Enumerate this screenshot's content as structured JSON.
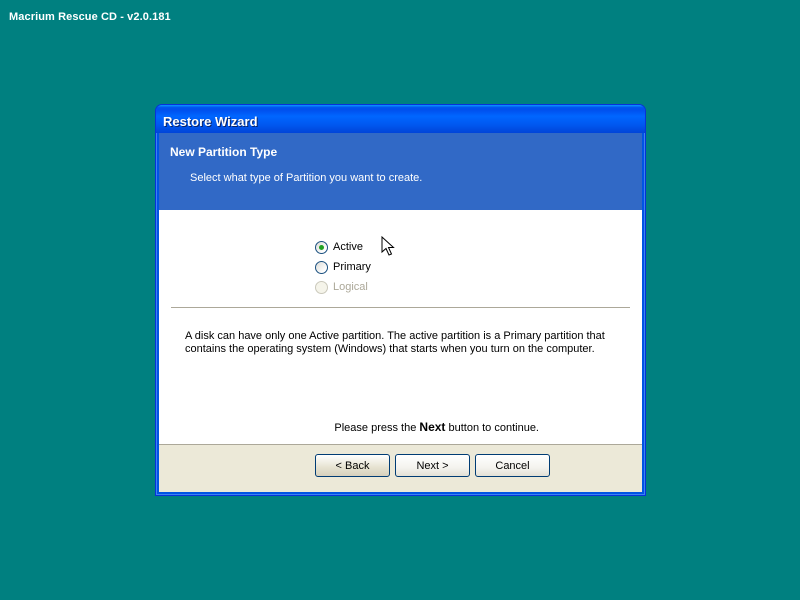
{
  "desktop": {
    "title": "Macrium Rescue CD - v2.0.181"
  },
  "dialog": {
    "title": "Restore Wizard",
    "header": {
      "title": "New Partition Type",
      "subtitle": "Select what type of Partition you want to create."
    },
    "options": [
      {
        "label": "Active",
        "checked": true,
        "disabled": false
      },
      {
        "label": "Primary",
        "checked": false,
        "disabled": false
      },
      {
        "label": "Logical",
        "checked": false,
        "disabled": true
      }
    ],
    "description": "A disk can have only one Active partition. The active partition is a Primary partition that contains the operating system (Windows) that starts when you turn on the computer.",
    "continue_text": {
      "before": "Please press the ",
      "bold": "Next",
      "after": " button to continue."
    },
    "buttons": {
      "back": "< Back",
      "next": "Next >",
      "cancel": "Cancel"
    }
  },
  "colors": {
    "desktop": "#008080",
    "header_band": "#3169c6",
    "title_bar": "#0058f0",
    "radio_check": "#21a121"
  },
  "icons": {
    "cursor": "mouse-pointer-icon"
  }
}
